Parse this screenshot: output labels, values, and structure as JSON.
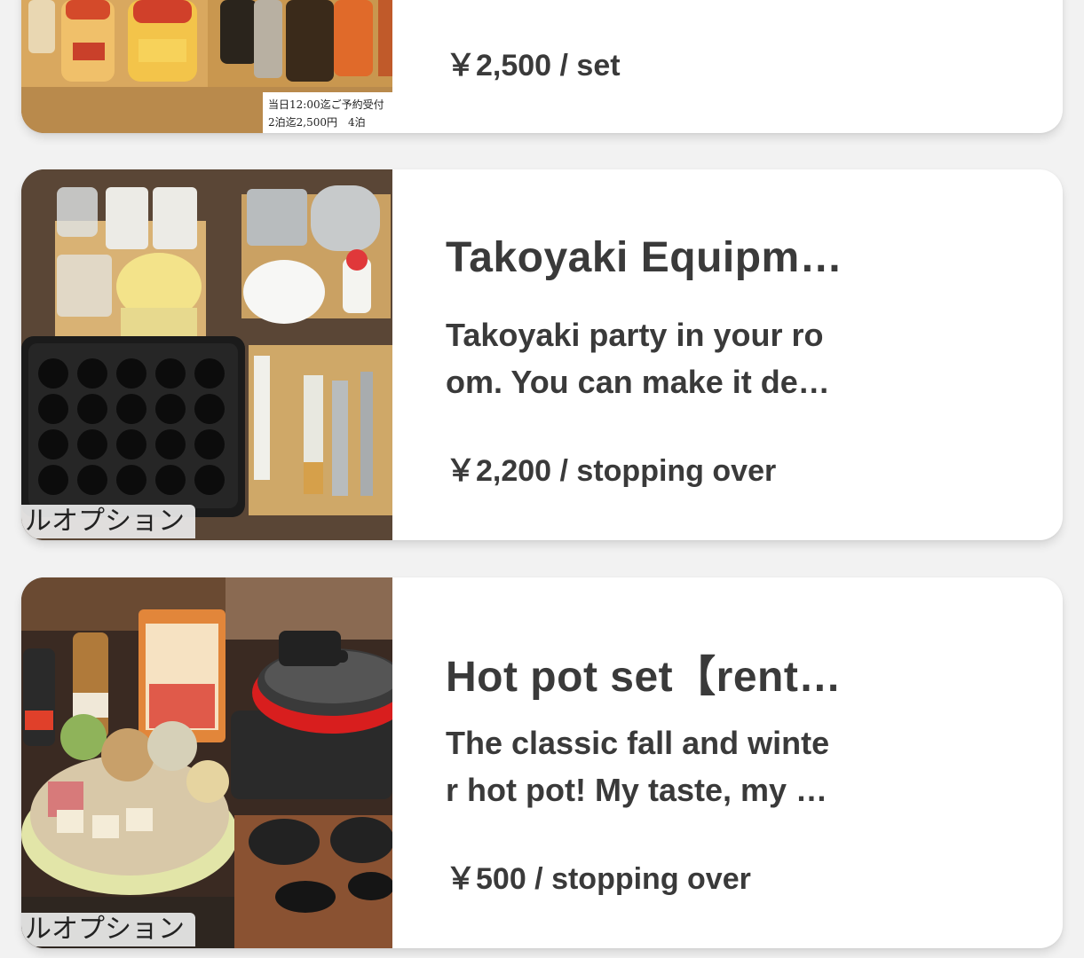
{
  "items": [
    {
      "price": "￥2,500 / set",
      "image_caption_line1": "当日12:00迄ご予約受付",
      "image_caption_line2": "2泊迄2,500円　4泊"
    },
    {
      "title": "Takoyaki Equipm…",
      "description_line1": "Takoyaki party in your ro",
      "description_line2": "om. You can make it de…",
      "price": "￥2,200 / stopping over",
      "tag": "ルオプション"
    },
    {
      "title": "Hot pot set【rent…",
      "description_line1": "The classic fall and winte",
      "description_line2": "r hot pot! My taste, my …",
      "price": "￥500 / stopping over",
      "tag": "ルオプション"
    }
  ],
  "colors": {
    "background": "#f2f2f2",
    "card": "#ffffff",
    "text": "#3a3a3a"
  },
  "icons": [
    "seasoning-photo",
    "takoyaki-equipment-photo",
    "hot-pot-photo"
  ]
}
